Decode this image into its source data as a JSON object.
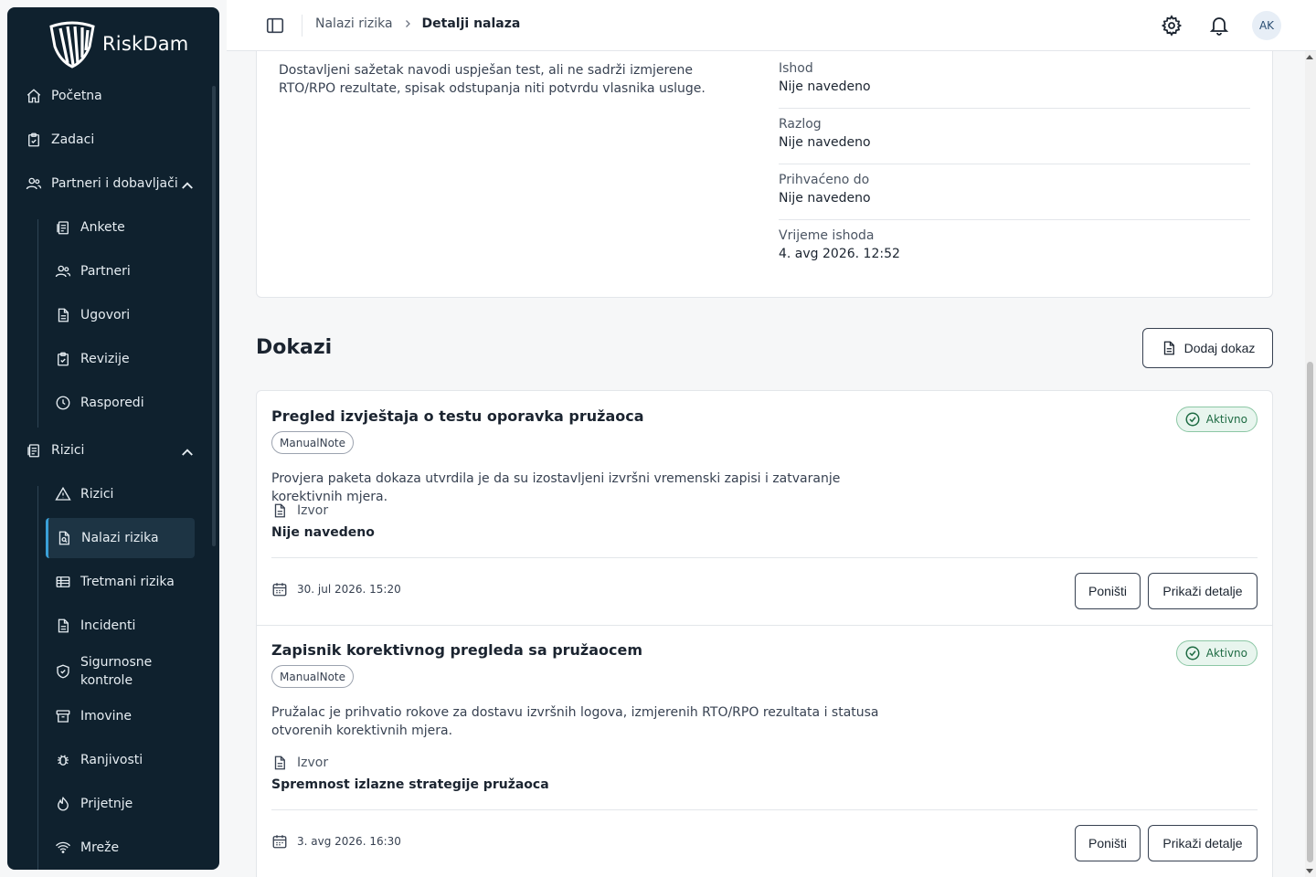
{
  "app": {
    "name": "RiskDam"
  },
  "sidebar": {
    "items": [
      {
        "label": "Početna"
      },
      {
        "label": "Zadaci"
      },
      {
        "label": "Partneri i dobavljači"
      },
      {
        "label": "Ankete"
      },
      {
        "label": "Partneri"
      },
      {
        "label": "Ugovori"
      },
      {
        "label": "Revizije"
      },
      {
        "label": "Rasporedi"
      },
      {
        "label": "Rizici"
      },
      {
        "label": "Rizici"
      },
      {
        "label": "Nalazi rizika"
      },
      {
        "label": "Tretmani rizika"
      },
      {
        "label": "Incidenti"
      },
      {
        "label": "Sigurnosne kontrole"
      },
      {
        "label": "Imovine"
      },
      {
        "label": "Ranjivosti"
      },
      {
        "label": "Prijetnje"
      },
      {
        "label": "Mreže"
      }
    ]
  },
  "topbar": {
    "breadcrumb": [
      "Nalazi rizika",
      "Detalji nalaza"
    ],
    "avatar_initials": "AK"
  },
  "summary": {
    "description": "Dostavljeni sažetak navodi uspješan test, ali ne sadrži izmjerene RTO/RPO rezultate, spisak odstupanja niti potvrdu vlasnika usluge.",
    "fields": [
      {
        "label": "Ishod",
        "value": "Nije navedeno"
      },
      {
        "label": "Razlog",
        "value": "Nije navedeno"
      },
      {
        "label": "Prihvaćeno do",
        "value": "Nije navedeno"
      },
      {
        "label": "Vrijeme ishoda",
        "value": "4. avg 2026. 12:52"
      }
    ]
  },
  "evidence": {
    "title": "Dokazi",
    "add_label": "Dodaj dokaz",
    "items": [
      {
        "title": "Pregled izvještaja o testu oporavka pružaoca",
        "tag": "ManualNote",
        "status": "Aktivno",
        "description": "Provjera paketa dokaza utvrdila je da su izostavljeni izvršni vremenski zapisi i zatvaranje korektivnih mjera.",
        "source_label": "Izvor",
        "source_value": "Nije navedeno",
        "date": "30. jul 2026. 15:20",
        "cancel_label": "Poništi",
        "details_label": "Prikaži detalje"
      },
      {
        "title": "Zapisnik korektivnog pregleda sa pružaocem",
        "tag": "ManualNote",
        "status": "Aktivno",
        "description": "Pružalac je prihvatio rokove za dostavu izvršnih logova, izmjerenih RTO/RPO rezultata i statusa otvorenih korektivnih mjera.",
        "source_label": "Izvor",
        "source_value": "Spremnost izlazne strategije pružaoca",
        "date": "3. avg 2026. 16:30",
        "cancel_label": "Poništi",
        "details_label": "Prikaži detalje"
      }
    ]
  },
  "icons": {
    "sidebar": [
      "home-icon",
      "tasks-icon",
      "users-icon",
      "survey-icon",
      "users-icon",
      "document-icon",
      "audit-icon",
      "clock-icon",
      "risks-icon",
      "warning-icon",
      "file-search-icon",
      "table-icon",
      "document-icon",
      "shield-check-icon",
      "archive-icon",
      "bug-icon",
      "flame-icon",
      "wifi-icon"
    ],
    "topbar": [
      "sidebar-toggle-icon",
      "gear-icon",
      "bell-icon"
    ]
  },
  "colors": {
    "sidebar_bg": "#0f212e",
    "active_accent": "#3aa0d8",
    "status_green": "#1e6b43"
  }
}
